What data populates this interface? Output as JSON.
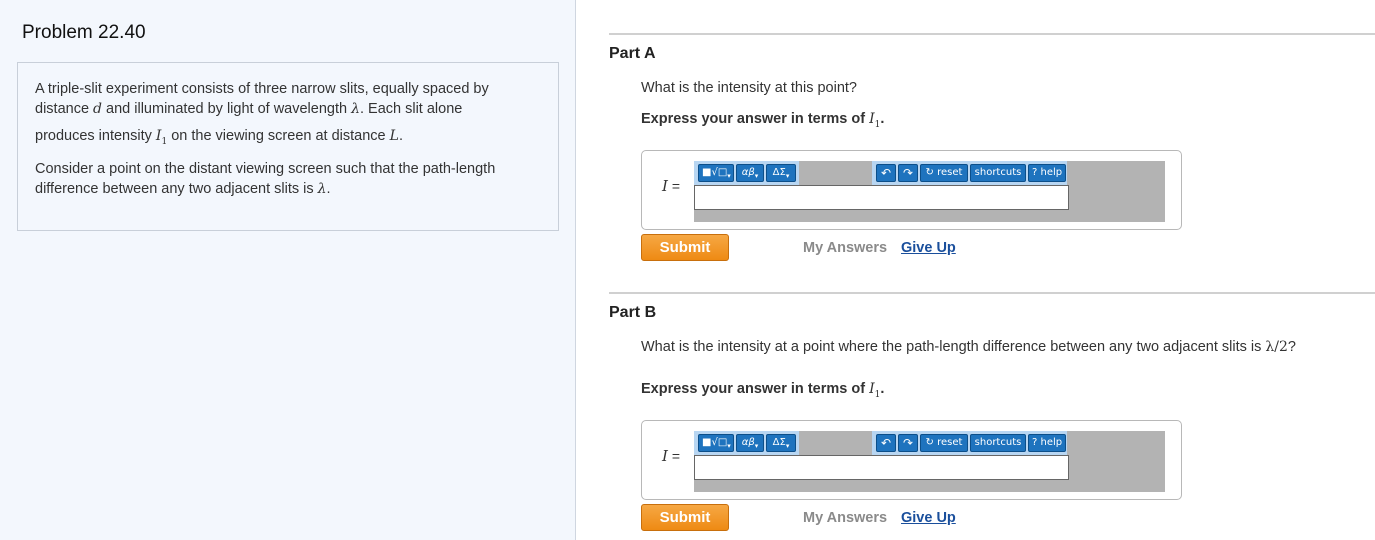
{
  "problem": {
    "title": "Problem 22.40",
    "p1_a": "A triple-slit experiment consists of three narrow slits, equally spaced by",
    "p1_b": "distance",
    "p1_var_d": "d",
    "p1_c": "and illuminated by light of wavelength",
    "p1_var_lambda": "λ",
    "p1_d": ". Each slit alone",
    "p2_a": "produces intensity",
    "p2_var_I": "I",
    "p2_var_I_sub": "1",
    "p2_b": "on the viewing screen at distance",
    "p2_var_L": "L",
    "p2_c": ".",
    "p3_a": "Consider a point on the distant viewing screen such that the path-length",
    "p3_b": "difference between any two adjacent slits is",
    "p3_var_lambda": "λ",
    "p3_c": "."
  },
  "part_a": {
    "title": "Part A",
    "question": "What is the intensity at this point?",
    "instruction_prefix": "Express your answer in terms of",
    "instruction_var": "I",
    "instruction_sub": "1",
    "instruction_suffix": ".",
    "var_label": "I",
    "equals": "=",
    "answer_value": "",
    "toolbar": {
      "templates": "■√□",
      "greek": "αβ",
      "symbols": "ΔΣ",
      "undo": "↶",
      "redo": "↷",
      "reset": "↻ reset",
      "shortcuts": "shortcuts",
      "help": "? help"
    },
    "submit_label": "Submit",
    "my_answers_label": "My Answers",
    "give_up_label": "Give Up"
  },
  "part_b": {
    "title": "Part B",
    "question_prefix": "What is the intensity at a point where the path-length difference between any two adjacent slits is",
    "question_math": "λ/2",
    "question_suffix": "?",
    "instruction_prefix": "Express your answer in terms of",
    "instruction_var": "I",
    "instruction_sub": "1",
    "instruction_suffix": ".",
    "var_label": "I",
    "equals": "=",
    "answer_value": "",
    "toolbar": {
      "templates": "■√□",
      "greek": "αβ",
      "symbols": "ΔΣ",
      "undo": "↶",
      "redo": "↷",
      "reset": "↻ reset",
      "shortcuts": "shortcuts",
      "help": "? help"
    },
    "submit_label": "Submit",
    "my_answers_label": "My Answers",
    "give_up_label": "Give Up"
  },
  "colors": {
    "submit_orange": "#ee8a13",
    "link_blue": "#1a4f9c",
    "toolbar_blue": "#1e73be",
    "left_pane_bg": "#f3f7fd"
  }
}
